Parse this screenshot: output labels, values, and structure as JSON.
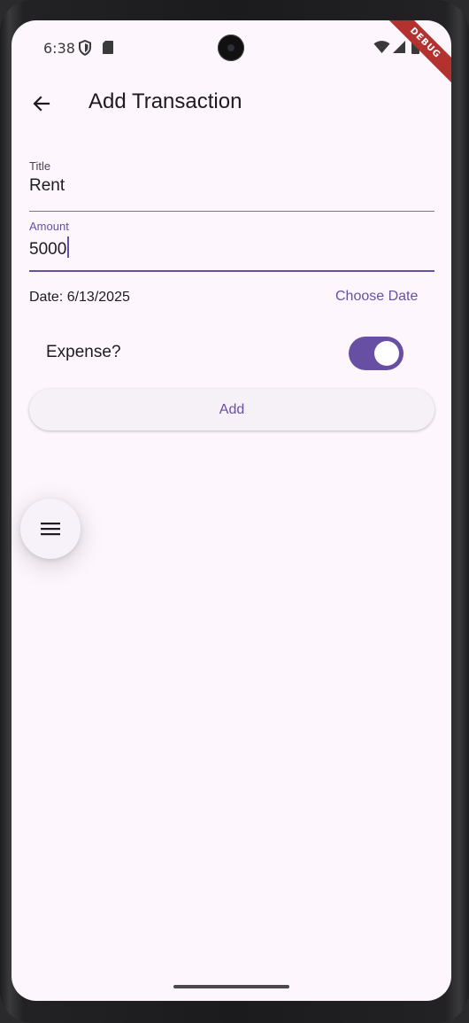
{
  "status_bar": {
    "time": "6:38",
    "icons": [
      "shield-icon",
      "sd-card-icon",
      "wifi-icon",
      "cell-signal-icon",
      "battery-icon"
    ]
  },
  "debug_banner": "DEBUG",
  "app_bar": {
    "title": "Add Transaction",
    "back_icon": "arrow-left-icon"
  },
  "form": {
    "title_field": {
      "label": "Title",
      "value": "Rent"
    },
    "amount_field": {
      "label": "Amount",
      "value": "5000"
    },
    "date_text": "Date: 6/13/2025",
    "choose_date_label": "Choose Date",
    "expense_label": "Expense?",
    "expense_on": true,
    "add_label": "Add"
  },
  "fab": {
    "icon": "menu-icon"
  },
  "colors": {
    "primary": "#6750a4",
    "background": "#fdf7fd",
    "text": "#1d1b20"
  }
}
